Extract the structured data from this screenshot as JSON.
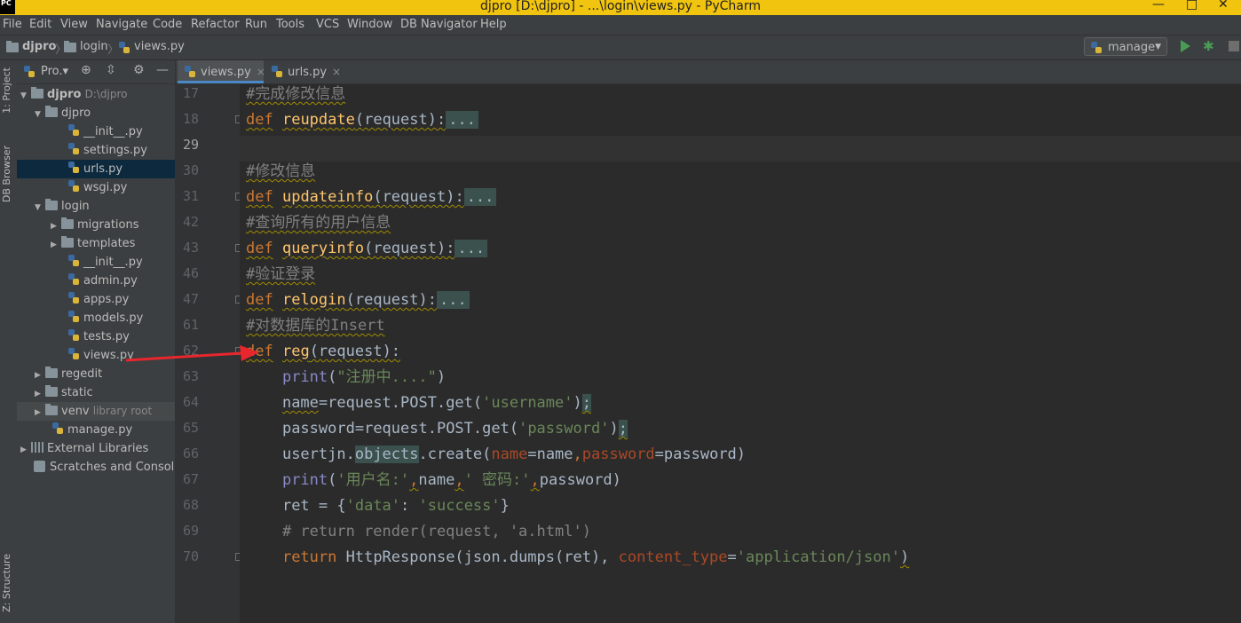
{
  "window": {
    "title": "djpro [D:\\djpro] - ...\\login\\views.py - PyCharm",
    "app_icon": "PC"
  },
  "menu": [
    "File",
    "Edit",
    "View",
    "Navigate",
    "Code",
    "Refactor",
    "Run",
    "Tools",
    "VCS",
    "Window",
    "DB Navigator",
    "Help"
  ],
  "breadcrumb": [
    "djpro",
    "login",
    "views.py"
  ],
  "run_config": {
    "label": "manage"
  },
  "left_tabs": {
    "project": "1: Project",
    "db": "DB Browser",
    "structure": "Z: Structure"
  },
  "project_header": {
    "label": "Pro.▾"
  },
  "tree": [
    {
      "label": "djpro",
      "hint": "D:\\djpro"
    },
    {
      "label": "djpro"
    },
    {
      "label": "__init__.py"
    },
    {
      "label": "settings.py"
    },
    {
      "label": "urls.py"
    },
    {
      "label": "wsgi.py"
    },
    {
      "label": "login"
    },
    {
      "label": "migrations"
    },
    {
      "label": "templates"
    },
    {
      "label": "__init__.py"
    },
    {
      "label": "admin.py"
    },
    {
      "label": "apps.py"
    },
    {
      "label": "models.py"
    },
    {
      "label": "tests.py"
    },
    {
      "label": "views.py"
    },
    {
      "label": "regedit"
    },
    {
      "label": "static"
    },
    {
      "label": "venv",
      "hint": "library root"
    },
    {
      "label": "manage.py"
    },
    {
      "label": "External Libraries"
    },
    {
      "label": "Scratches and Consoles"
    }
  ],
  "tabs": [
    {
      "label": "views.py",
      "close": "×"
    },
    {
      "label": "urls.py",
      "close": "×"
    }
  ],
  "line_numbers": [
    "17",
    "18",
    "29",
    "30",
    "31",
    "42",
    "43",
    "46",
    "47",
    "61",
    "62",
    "63",
    "64",
    "65",
    "66",
    "67",
    "68",
    "69",
    "70"
  ],
  "code": {
    "l17": "#完成修改信息",
    "l18_name": "reupdate",
    "l18_params": "(request):",
    "l30": "#修改信息",
    "l31_name": "updateinfo",
    "l31_params": "(request):",
    "l42": "#查询所有的用户信息",
    "l43_name": "queryinfo",
    "l43_params": "(request):",
    "l46": "#验证登录",
    "l47_name": "relogin",
    "l47_params": "(request):",
    "l61": "#对数据库的Insert",
    "l62_name": "reg",
    "l62_params": "(request):",
    "def": "def",
    "dots": "...",
    "l63_str": "\"注册中....\"",
    "l64_a": "name",
    "l64_b": "=request.POST.get(",
    "l64_str": "'username'",
    "l64_c": ")",
    "l64_semi": ";",
    "l65_a": "password",
    "l65_b": "=request.POST.get(",
    "l65_str": "'password'",
    "l65_c": ")",
    "l65_semi": ";",
    "l66_a": "usertjn.",
    "l66_obj": "objects",
    "l66_b": ".create(",
    "l66_k1": "name",
    "l66_v1": "=name",
    "l66_k2": "password",
    "l66_v2": "=password)",
    "l67_s1": "'用户名:'",
    "l67_a": "name",
    "l67_s2": "' 密码:'",
    "l67_b": "password)",
    "l68_a": "ret = {",
    "l68_s1": "'data'",
    "l68_b": ": ",
    "l68_s2": "'success'",
    "l68_c": "}",
    "l69": "# return render(request, 'a.html')",
    "l70_kw": "return",
    "l70_a": " HttpResponse(json.dumps(ret), ",
    "l70_k": "content_type",
    "l70_eq": "=",
    "l70_s": "'application/json'",
    "l70_c": ")",
    "print": "print"
  },
  "colors": {
    "accent": "#4a88c7",
    "keyword": "#cc7832",
    "function": "#ffc66d",
    "string": "#6a8759",
    "comment": "#808080",
    "annotation_arrow": "#e8262d"
  }
}
